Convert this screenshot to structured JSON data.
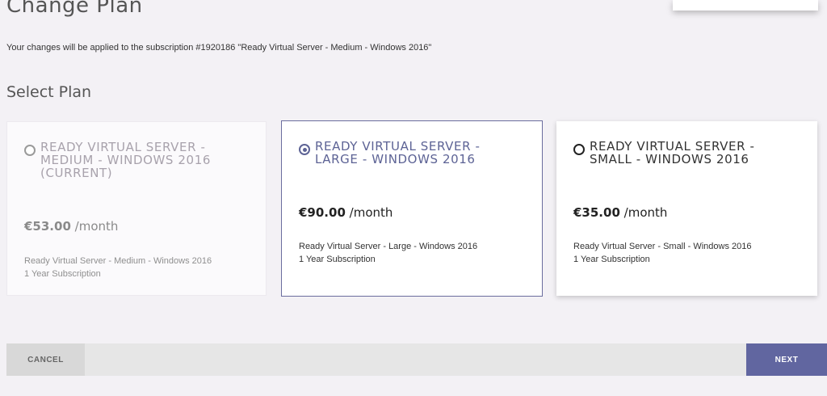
{
  "header": {
    "title": "Change Plan",
    "subtitle": "Your changes will be applied to the subscription #1920186 \"Ready Virtual Server - Medium - Windows 2016\""
  },
  "section": {
    "title": "Select Plan"
  },
  "plans": [
    {
      "name": "Ready Virtual Server - Medium - Windows 2016 (current)",
      "price": "€53.00",
      "period": "/month",
      "desc_line1": "Ready Virtual Server - Medium - Windows 2016",
      "desc_line2": "1 Year Subscription",
      "state": "current"
    },
    {
      "name": "Ready Virtual Server - Large - Windows 2016",
      "price": "€90.00",
      "period": "/month",
      "desc_line1": "Ready Virtual Server - Large - Windows 2016",
      "desc_line2": "1 Year Subscription",
      "state": "selected"
    },
    {
      "name": "Ready Virtual Server - Small - Windows 2016",
      "price": "€35.00",
      "period": "/month",
      "desc_line1": "Ready Virtual Server - Small - Windows 2016",
      "desc_line2": "1 Year Subscription",
      "state": "available"
    }
  ],
  "footer": {
    "cancel_label": "Cancel",
    "next_label": "Next"
  },
  "colors": {
    "accent": "#6166a0",
    "background": "#f3f1f5",
    "muted_text": "#a8a2ac"
  }
}
